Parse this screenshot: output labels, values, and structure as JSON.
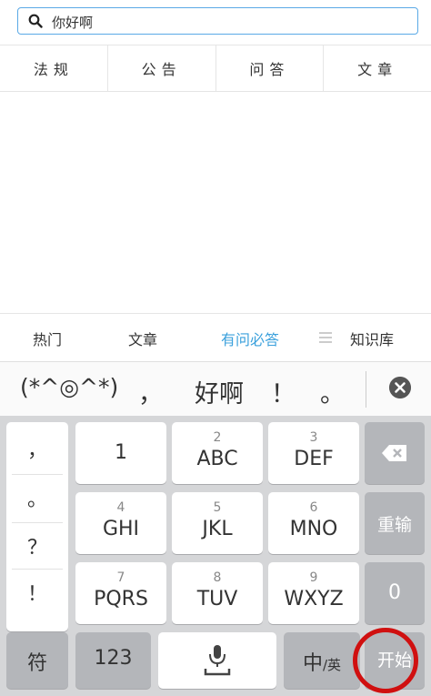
{
  "search": {
    "value": "你好啊"
  },
  "category_tabs": [
    "法规",
    "公告",
    "问答",
    "文章"
  ],
  "bottom_nav": {
    "items": [
      "热门",
      "文章",
      "有问必答",
      "知识库"
    ],
    "active": "有问必答"
  },
  "candidates": [
    "(*^◎^*)",
    "，",
    "好啊",
    "！",
    "。"
  ],
  "keyboard": {
    "punct": [
      "，",
      "。",
      "？",
      "！"
    ],
    "keys": [
      {
        "num": "",
        "main": "1"
      },
      {
        "num": "2",
        "main": "ABC"
      },
      {
        "num": "3",
        "main": "DEF"
      },
      {
        "num": "4",
        "main": "GHI"
      },
      {
        "num": "5",
        "main": "JKL"
      },
      {
        "num": "6",
        "main": "MNO"
      },
      {
        "num": "7",
        "main": "PQRS"
      },
      {
        "num": "8",
        "main": "TUV"
      },
      {
        "num": "9",
        "main": "WXYZ"
      }
    ],
    "reenter": "重输",
    "zero": "0",
    "symbols": "符",
    "numbers": "123",
    "lang_cn": "中",
    "lang_en": "/英",
    "start": "开始"
  },
  "colors": {
    "accent": "#3aa0dc",
    "annotation": "#d01010"
  }
}
